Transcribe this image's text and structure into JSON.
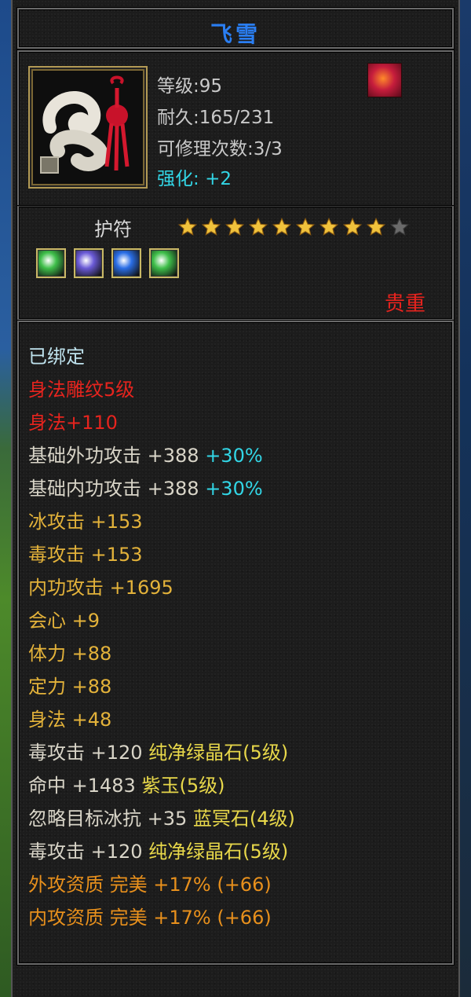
{
  "item": {
    "name": "飞雪",
    "level_text": "等级:95",
    "durability_text": "耐久:165/231",
    "repair_text": "可修理次数:3/3",
    "enhance_label": "强化:",
    "enhance_value": "+2",
    "type": "护符",
    "stars_filled": 9,
    "stars_total": 10,
    "rarity": "贵重",
    "icon": "jade-pendant-icon",
    "buff_icon": "flame-buff-icon"
  },
  "gems": [
    {
      "name": "green-gem-icon",
      "color": "#3fbf4a"
    },
    {
      "name": "purple-gem-icon",
      "color": "#6a5ad6"
    },
    {
      "name": "blue-gem-icon",
      "color": "#2a6ee6"
    },
    {
      "name": "green-gem-icon",
      "color": "#3fbf4a"
    }
  ],
  "stats": {
    "bound": "已绑定",
    "engrave": "身法雕纹5级",
    "engrave_bonus": "身法+110",
    "ext_attack": "基础外功攻击 +388",
    "ext_attack_pct": "+30%",
    "int_attack": "基础内功攻击 +388",
    "int_attack_pct": "+30%",
    "ice_attack": "冰攻击 +153",
    "poison_attack": "毒攻击 +153",
    "inner_attack": "内功攻击 +1695",
    "crit": "会心 +9",
    "stamina": "体力 +88",
    "focus": "定力 +88",
    "agility": "身法 +48",
    "gem1_stat": "毒攻击 +120",
    "gem1_name": "纯净绿晶石(5级)",
    "gem2_stat": "命中 +1483",
    "gem2_name": "紫玉(5级)",
    "gem3_stat": "忽略目标冰抗 +35",
    "gem3_name": "蓝冥石(4级)",
    "gem4_stat": "毒攻击 +120",
    "gem4_name": "纯净绿晶石(5级)",
    "aptitude_ext": "外攻资质  完美 +17% (+66)",
    "aptitude_int": "内攻资质  完美 +17% (+66)"
  },
  "colors": {
    "title": "#2a7ef2",
    "rarity": "#e6241e",
    "bonus_pct": "#32d6e6",
    "gold_stat": "#e3b23a",
    "aptitude": "#e8901c"
  }
}
